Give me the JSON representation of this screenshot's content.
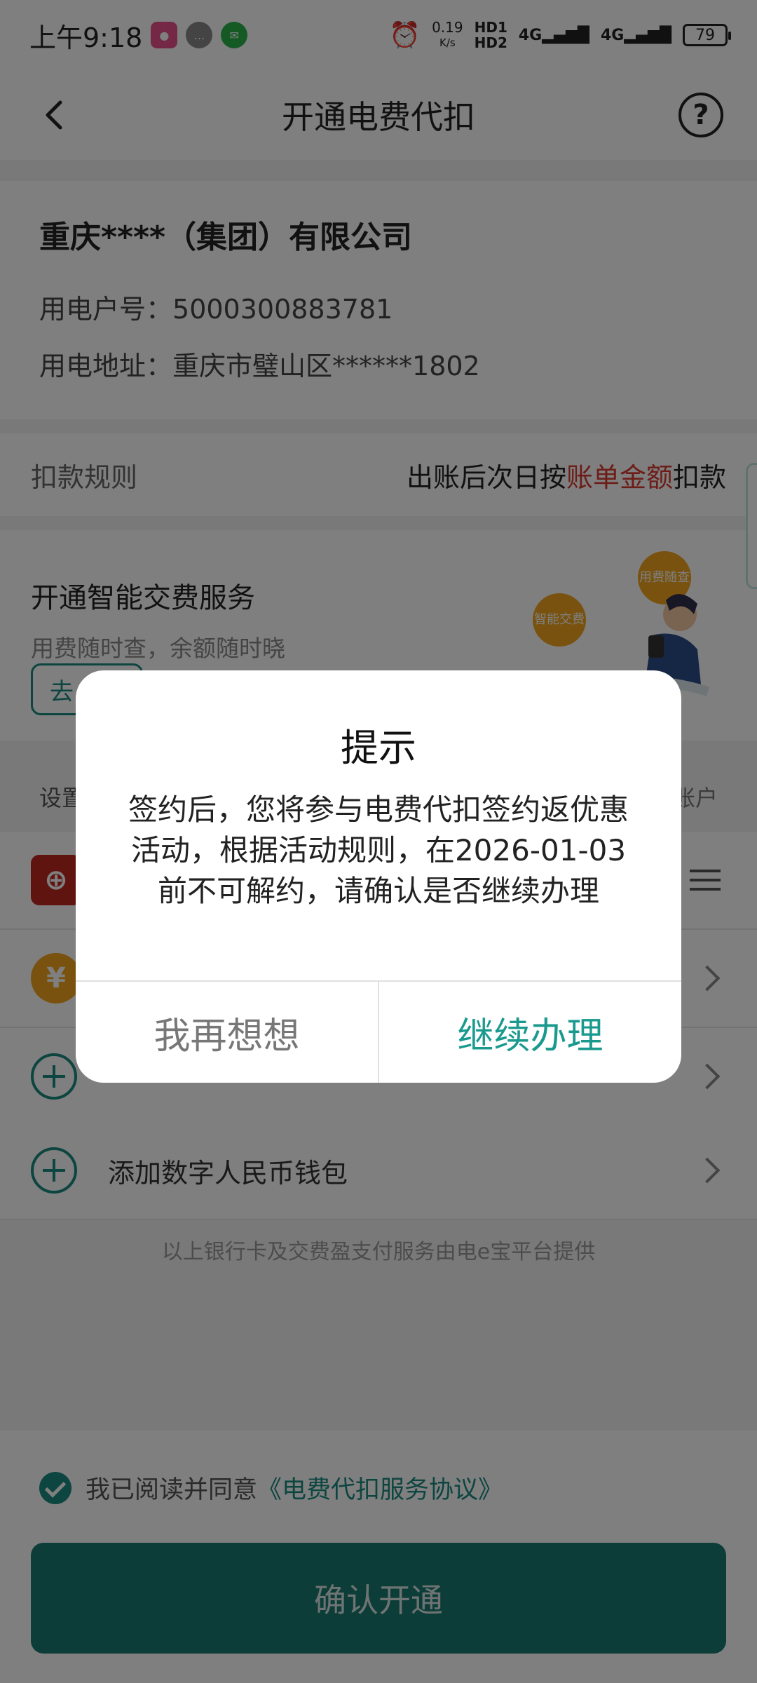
{
  "status_bar": {
    "time": "上午9:18",
    "net_speed": "0.19",
    "net_unit": "K/s",
    "hd1": "HD1",
    "hd2": "HD2",
    "sig1": "4G",
    "sig2": "4G",
    "battery": "79"
  },
  "nav": {
    "title": "开通电费代扣",
    "help": "?"
  },
  "account": {
    "company": "重庆****（集团）有限公司",
    "account_label": "用电户号：",
    "account_no": "5000300883781",
    "address_label": "用电地址：",
    "address": "重庆市璧山区******1802"
  },
  "rule": {
    "label": "扣款规则",
    "text_pre": "出账后次日按",
    "text_highlight": "账单金额",
    "text_post": "扣款"
  },
  "service": {
    "title": "开通智能交费服务",
    "subtitle": "用费随时查，余额随时晓",
    "button": "去",
    "bubble1": "用费随查",
    "bubble2": "智能交费"
  },
  "payment": {
    "header_left": "设置",
    "header_right": "账户",
    "rows": [
      {
        "label": ""
      },
      {
        "label": ""
      },
      {
        "label": ""
      },
      {
        "label": "添加数字人民币钱包"
      }
    ],
    "footnote": "以上银行卡及交费盈支付服务由电e宝平台提供"
  },
  "agreement": {
    "prefix": "我已阅读并同意",
    "link": "《电费代扣服务协议》",
    "confirm": "确认开通"
  },
  "dialog": {
    "title": "提示",
    "body": "签约后，您将参与电费代扣签约返优惠活动，根据活动规则，在2026-01-03前不可解约，请确认是否继续办理",
    "cancel": "我再想想",
    "ok": "继续办理"
  },
  "colors": {
    "accent": "#1a8a80",
    "highlight": "#d93b30",
    "bank_red": "#c0281f",
    "coin_gold": "#f0a51c"
  }
}
